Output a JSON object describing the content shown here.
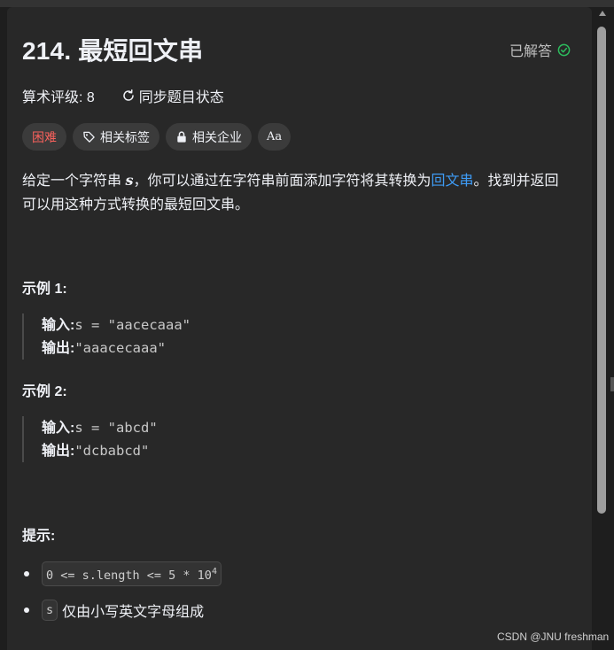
{
  "problem": {
    "title": "214. 最短回文串",
    "status": "已解答",
    "rating_label": "算术评级: 8",
    "sync_label": "同步题目状态"
  },
  "tags": {
    "difficulty": "困难",
    "related_tags": "相关标签",
    "related_companies": "相关企业",
    "font_icon": "Aa"
  },
  "description": {
    "part1": "给定一个字符串 ",
    "var": "s",
    "part2": "，你可以通过在字符串前面添加字符将其转换为",
    "link": "回文串",
    "part3": "。找到并返回可以用这种方式转换的最短回文串。"
  },
  "examples": [
    {
      "heading": "示例 1:",
      "input_label": "输入:",
      "input_value": "s = \"aacecaaa\"",
      "output_label": "输出:",
      "output_value": "\"aaacecaaa\""
    },
    {
      "heading": "示例 2:",
      "input_label": "输入:",
      "input_value": "s = \"abcd\"",
      "output_label": "输出:",
      "output_value": "\"dcbabcd\""
    }
  ],
  "hints": {
    "heading": "提示:",
    "constraint_code": "0 <= s.length <= 5 * 10",
    "constraint_exp": "4",
    "constraint2_code": "s",
    "constraint2_text": "仅由小写英文字母组成"
  },
  "watermark": "CSDN @JNU freshman",
  "colors": {
    "hard": "#f8615c",
    "link": "#3e9bf5",
    "solved_check": "#2cbb5d",
    "panel": "#282828"
  }
}
